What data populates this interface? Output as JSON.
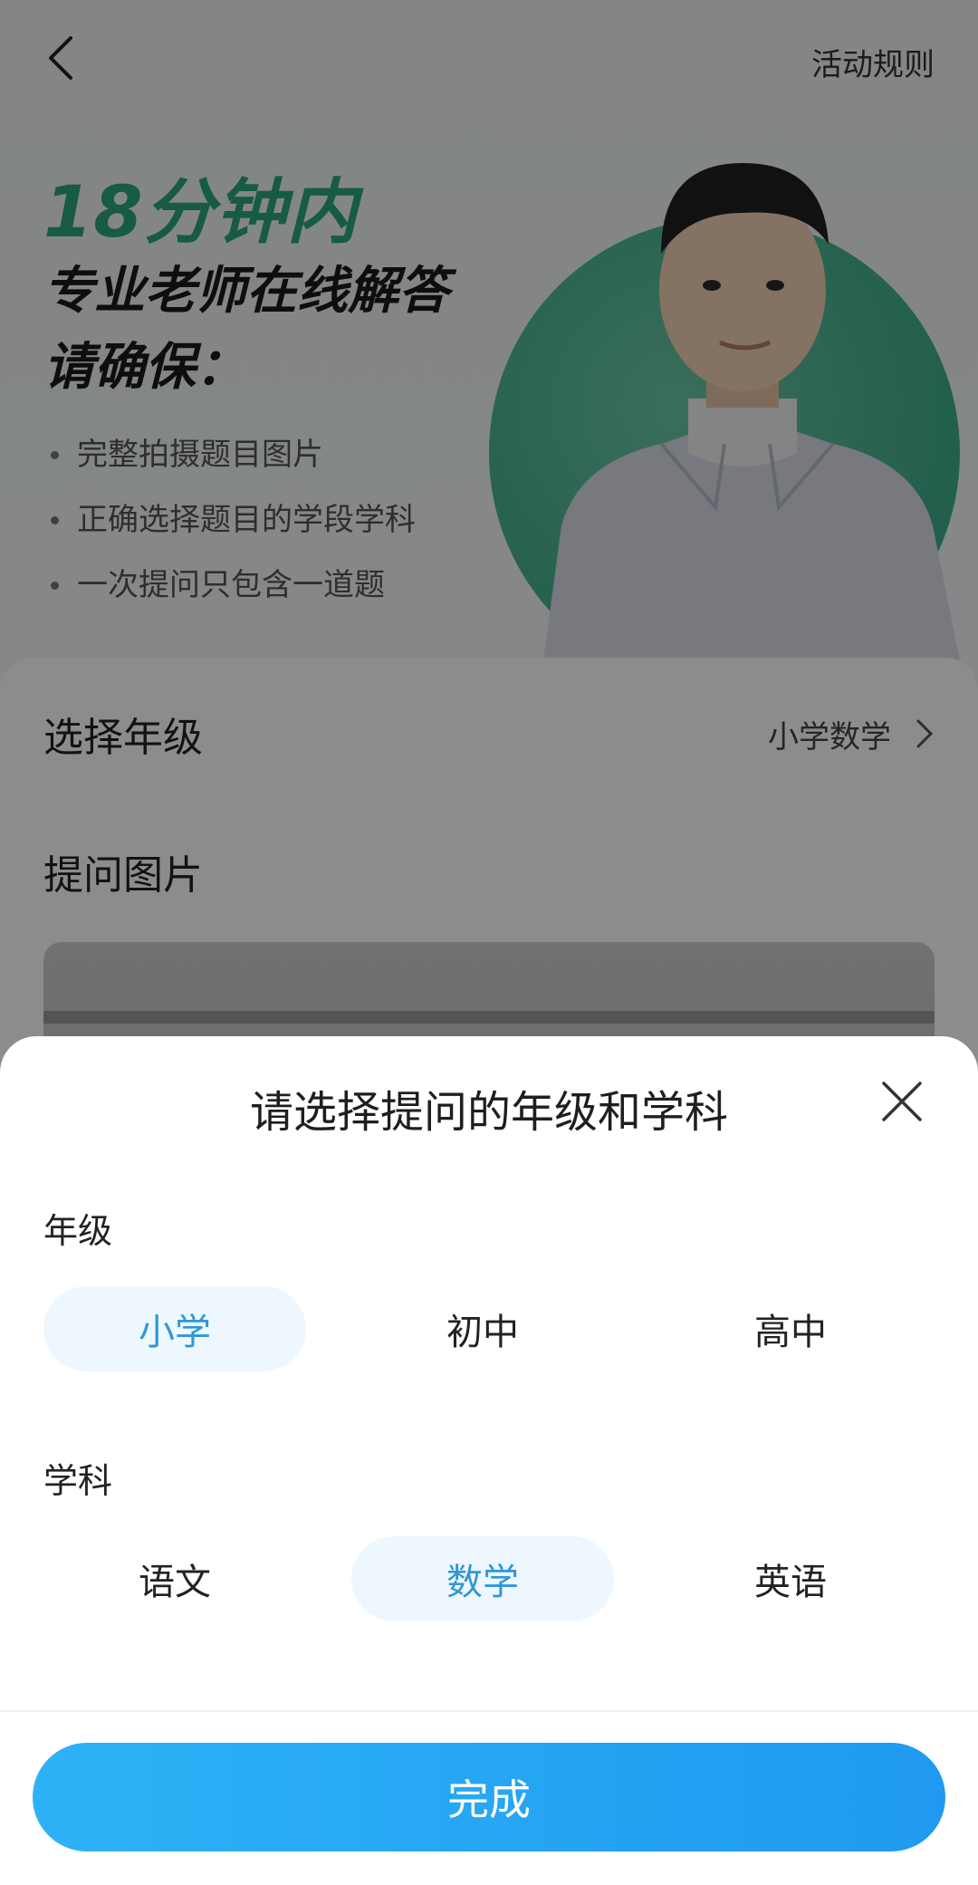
{
  "header": {
    "back_label": "",
    "rules_link": "活动规则"
  },
  "hero": {
    "highlight": "18分钟内",
    "title_line1": "专业老师在线解答",
    "title_line2": "请确保：",
    "tips": [
      "完整拍摄题目图片",
      "正确选择题目的学段学科",
      "一次提问只包含一道题"
    ]
  },
  "form": {
    "grade_row_label": "选择年级",
    "grade_row_value": "小学数学",
    "photo_label": "提问图片"
  },
  "sheet": {
    "title": "请选择提问的年级和学科",
    "grade_label": "年级",
    "grade_options": [
      "小学",
      "初中",
      "高中"
    ],
    "grade_selected": "小学",
    "subject_label": "学科",
    "subject_options": [
      "语文",
      "数学",
      "英语"
    ],
    "subject_selected": "数学",
    "done_button": "完成"
  },
  "colors": {
    "accent_green": "#2aa67a",
    "selected_text": "#2f97d8",
    "selected_bg": "#eef7fe",
    "button_blue": "#1f9af0"
  }
}
